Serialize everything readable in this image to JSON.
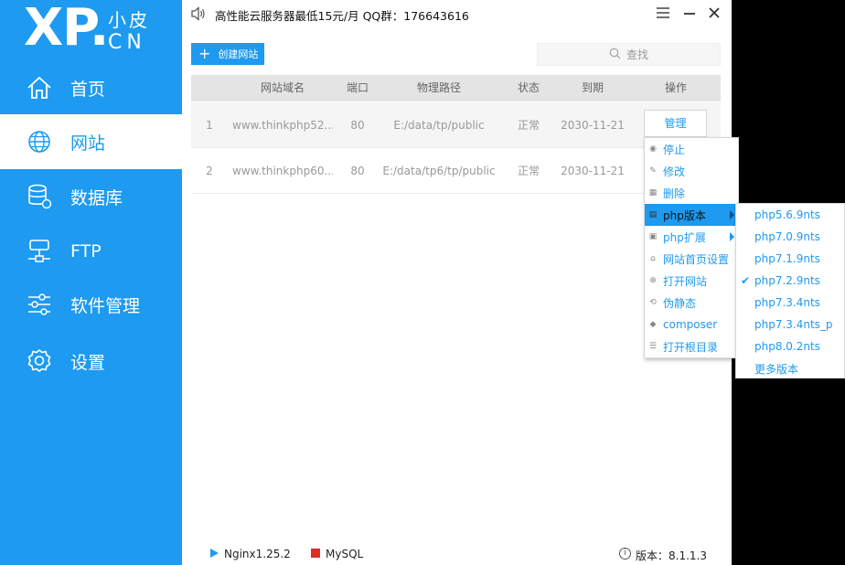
{
  "logo": {
    "main": "XP.",
    "name": "小皮",
    "sub": "CN"
  },
  "sidebar": {
    "items": [
      {
        "label": "首页",
        "icon": "home-icon"
      },
      {
        "label": "网站",
        "icon": "globe-icon",
        "active": true
      },
      {
        "label": "数据库",
        "icon": "database-icon"
      },
      {
        "label": "FTP",
        "icon": "ftp-server-icon"
      },
      {
        "label": "软件管理",
        "icon": "sliders-icon"
      },
      {
        "label": "设置",
        "icon": "gear-icon"
      }
    ],
    "color": "#1e9af0"
  },
  "topbar": {
    "notice": "高性能云服务器最低15元/月  QQ群：176643616",
    "notice_icon": "speaker-icon"
  },
  "toolbar": {
    "create_label": "创建网站",
    "search_placeholder": "查找"
  },
  "table": {
    "headers": [
      "网站域名",
      "端口",
      "物理路径",
      "状态",
      "到期",
      "操作"
    ],
    "rows": [
      {
        "index": "1",
        "domain": "www.thinkphp52...",
        "port": "80",
        "path": "E:/data/tp/public",
        "status": "正常",
        "expire": "2030-11-21",
        "action": "管理"
      },
      {
        "index": "2",
        "domain": "www.thinkphp60...",
        "port": "80",
        "path": "E:/data/tp6/tp/public",
        "status": "正常",
        "expire": "2030-11-21",
        "action": ""
      }
    ]
  },
  "context_menu": {
    "items": [
      {
        "label": "停止",
        "icon": "stop-icon"
      },
      {
        "label": "修改",
        "icon": "pencil-icon"
      },
      {
        "label": "删除",
        "icon": "trash-icon"
      },
      {
        "label": "php版本",
        "icon": "file-icon",
        "submenu": true,
        "highlighted": true
      },
      {
        "label": "php扩展",
        "icon": "extension-icon",
        "submenu": true
      },
      {
        "label": "网站首页设置",
        "icon": "home-small-icon"
      },
      {
        "label": "打开网站",
        "icon": "globe-small-icon"
      },
      {
        "label": "伪静态",
        "icon": "rewrite-icon"
      },
      {
        "label": "composer",
        "icon": "composer-icon"
      },
      {
        "label": "打开根目录",
        "icon": "list-icon"
      }
    ]
  },
  "php_versions": {
    "items": [
      {
        "label": "php5.6.9nts"
      },
      {
        "label": "php7.0.9nts"
      },
      {
        "label": "php7.1.9nts"
      },
      {
        "label": "php7.2.9nts",
        "checked": true
      },
      {
        "label": "php7.3.4nts"
      },
      {
        "label": "php7.3.4nts_p"
      },
      {
        "label": "php8.0.2nts"
      },
      {
        "label": "更多版本"
      }
    ]
  },
  "statusbar": {
    "nginx": "Nginx1.25.2",
    "mysql": "MySQL",
    "version": "版本：8.1.1.3",
    "nginx_color": "#1e9af0",
    "mysql_color": "#e02b2b"
  }
}
